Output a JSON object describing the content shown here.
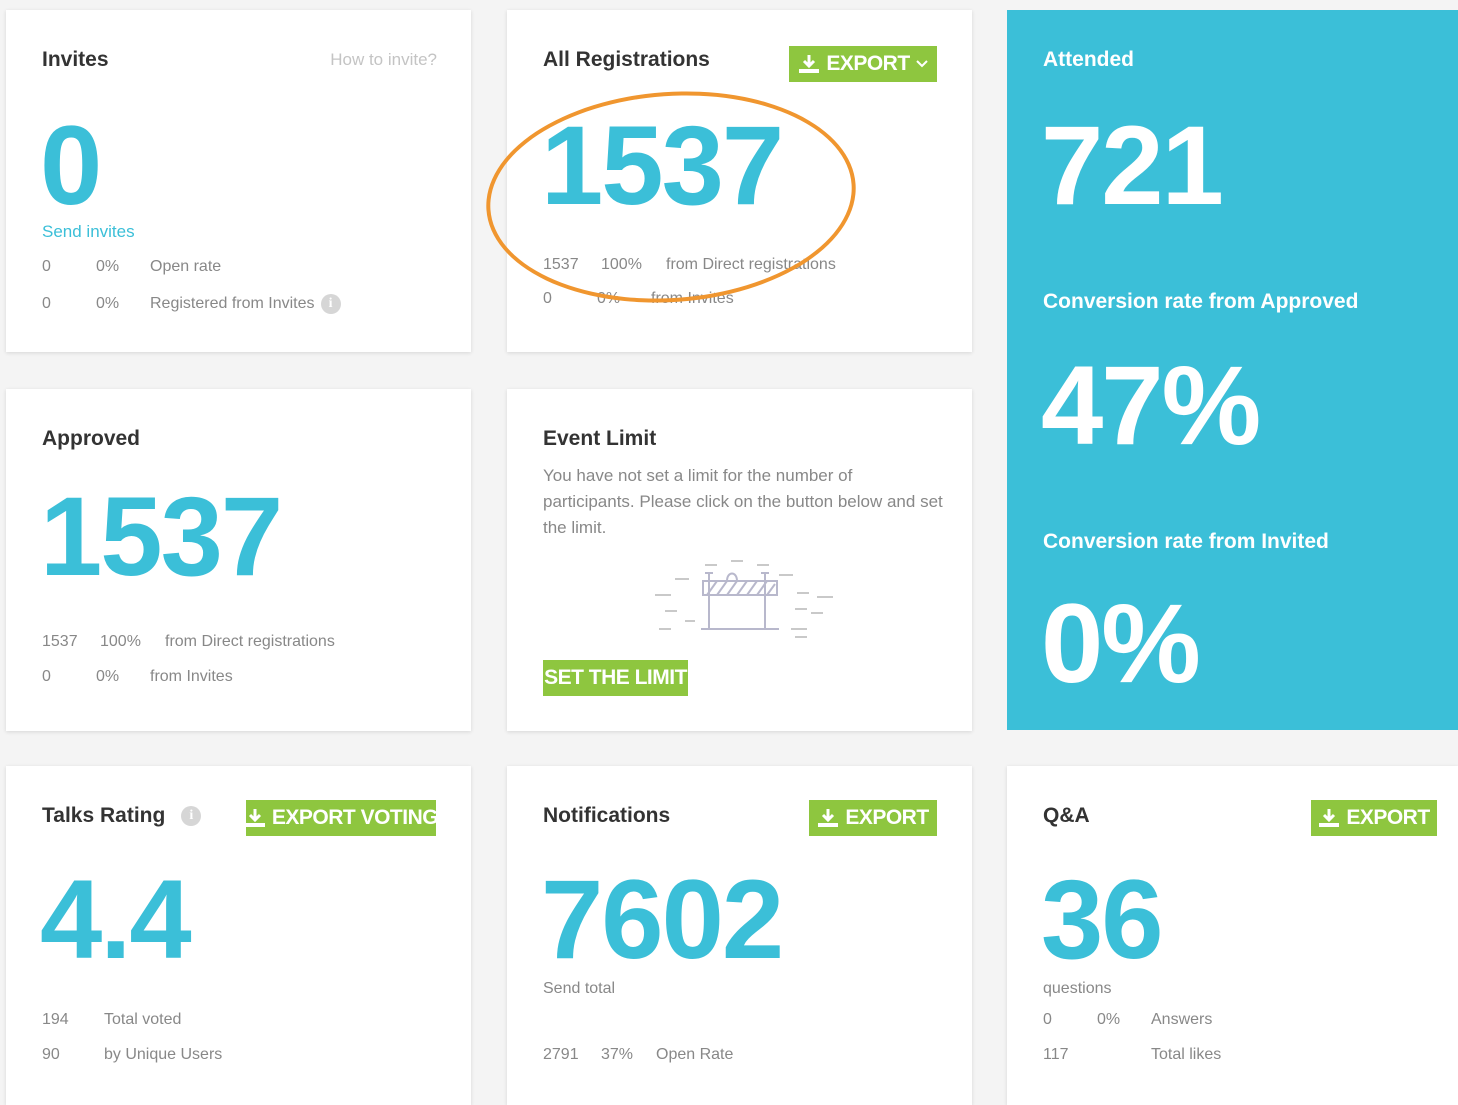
{
  "invites": {
    "title": "Invites",
    "help_link": "How to invite?",
    "value": "0",
    "send_link": "Send invites",
    "rows": [
      {
        "count": "0",
        "pct": "0%",
        "label": "Open rate"
      },
      {
        "count": "0",
        "pct": "0%",
        "label": "Registered from Invites"
      }
    ]
  },
  "all_registrations": {
    "title": "All Registrations",
    "export_label": "EXPORT",
    "value": "1537",
    "rows": [
      {
        "count": "1537",
        "pct": "100%",
        "label": "from Direct registrations"
      },
      {
        "count": "0",
        "pct": "0%",
        "label": "from Invites"
      }
    ]
  },
  "attended": {
    "title": "Attended",
    "value": "721",
    "conv_approved_label": "Conversion rate from Approved",
    "conv_approved_value": "47%",
    "conv_invited_label": "Conversion rate from Invited",
    "conv_invited_value": "0%"
  },
  "approved": {
    "title": "Approved",
    "value": "1537",
    "rows": [
      {
        "count": "1537",
        "pct": "100%",
        "label": "from Direct registrations"
      },
      {
        "count": "0",
        "pct": "0%",
        "label": "from Invites"
      }
    ]
  },
  "event_limit": {
    "title": "Event Limit",
    "description": "You have not set a limit for the number of participants. Please click on the button below and set the limit.",
    "button_label": "SET THE LIMIT"
  },
  "talks_rating": {
    "title": "Talks Rating",
    "export_label": "EXPORT VOTING",
    "value": "4.4",
    "rows": [
      {
        "count": "194",
        "label": "Total voted"
      },
      {
        "count": "90",
        "label": "by Unique Users"
      }
    ]
  },
  "notifications": {
    "title": "Notifications",
    "export_label": "EXPORT",
    "value": "7602",
    "send_total_label": "Send total",
    "rows": [
      {
        "count": "2791",
        "pct": "37%",
        "label": "Open Rate"
      }
    ]
  },
  "qa": {
    "title": "Q&A",
    "export_label": "EXPORT",
    "value": "36",
    "questions_label": "questions",
    "rows": [
      {
        "count": "0",
        "pct": "0%",
        "label": "Answers"
      },
      {
        "count": "117",
        "label": "Total likes"
      }
    ]
  },
  "colors": {
    "accent": "#3bbfd8",
    "button_green": "#8ec63f",
    "annotation_orange": "#f0962f"
  },
  "icons": [
    "download-icon",
    "chevron-down-icon",
    "info-icon",
    "barrier-icon"
  ]
}
